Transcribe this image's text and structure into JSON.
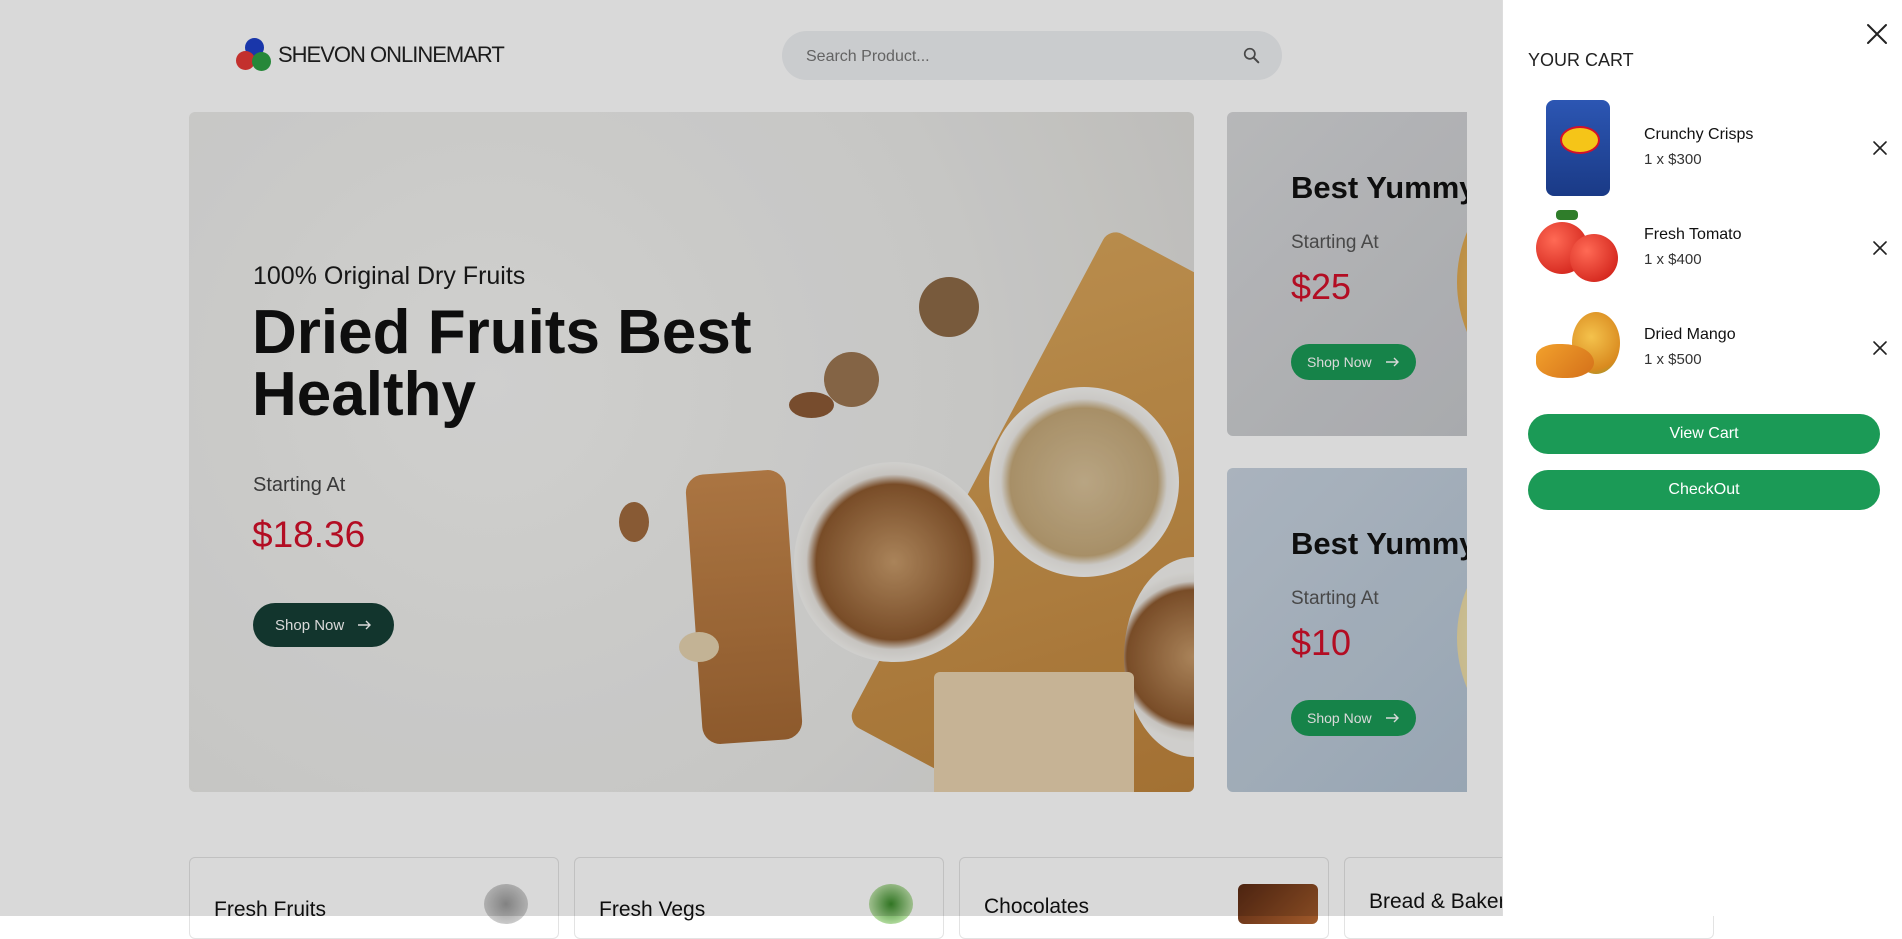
{
  "header": {
    "logo_text": "SHEVON ONLINEMART",
    "search_placeholder": "Search Product..."
  },
  "hero": {
    "subtitle": "100% Original Dry Fruits",
    "title": "Dried Fruits Best Healthy",
    "starting_label": "Starting At",
    "price": "$18.36",
    "button": "Shop Now"
  },
  "promo_cards": [
    {
      "title": "Best Yummy Pizza",
      "starting_label": "Starting At",
      "price": "$25",
      "button": "Shop Now"
    },
    {
      "title": "Best Yummy Chips",
      "starting_label": "Starting At",
      "price": "$10",
      "button": "Shop Now"
    }
  ],
  "categories": [
    {
      "label": "Fresh Fruits"
    },
    {
      "label": "Fresh Vegs"
    },
    {
      "label": "Chocolates"
    },
    {
      "label": "Bread & Bakery"
    }
  ],
  "cart": {
    "title": "YOUR CART",
    "items": [
      {
        "name": "Crunchy Crisps",
        "qty": "1 x $300"
      },
      {
        "name": "Fresh Tomato",
        "qty": "1 x $400"
      },
      {
        "name": "Dried Mango",
        "qty": "1 x $500"
      }
    ],
    "view_cart": "View Cart",
    "checkout": "CheckOut"
  },
  "colors": {
    "accent": "#1b9a56",
    "price": "#d3102a",
    "hero_button": "#163f35"
  }
}
